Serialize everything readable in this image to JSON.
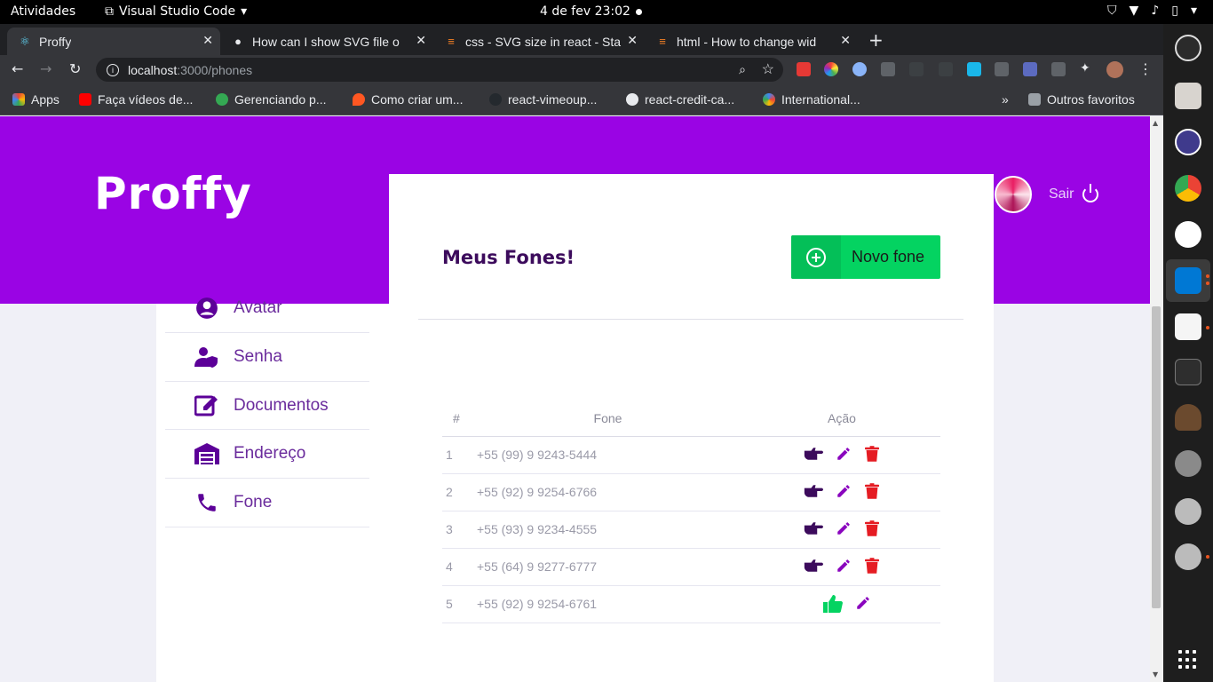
{
  "system_bar": {
    "activities": "Atividades",
    "app_name": "Visual Studio Code",
    "datetime": "4 de fev  23:02"
  },
  "browser": {
    "tabs": [
      {
        "title": "Proffy",
        "icon": "react-icon",
        "active": true
      },
      {
        "title": "How can I show SVG file o",
        "icon": "github-icon",
        "active": false
      },
      {
        "title": "css - SVG size in react - Sta",
        "icon": "stackoverflow-icon",
        "active": false
      },
      {
        "title": "html - How to change wid",
        "icon": "stackoverflow-icon",
        "active": false
      }
    ],
    "url_host": "localhost",
    "url_path": ":3000/phones",
    "bookmarks": [
      {
        "label": "Apps",
        "color": "#ea4335"
      },
      {
        "label": "Faça vídeos de...",
        "color": "#ff0000"
      },
      {
        "label": "Gerenciando p...",
        "color": "#34a853"
      },
      {
        "label": "Como criar um...",
        "color": "#ff5722"
      },
      {
        "label": "react-vimeoup...",
        "color": "#24292e"
      },
      {
        "label": "react-credit-ca...",
        "color": "#e8eaed"
      },
      {
        "label": "International...",
        "color": "#4285f4"
      }
    ],
    "other_bookmarks": "Outros favoritos"
  },
  "header": {
    "logo": "Proffy",
    "logout": "Sair"
  },
  "sidebar": {
    "items": [
      {
        "label": "Avatar",
        "icon": "user-circle-icon"
      },
      {
        "label": "Senha",
        "icon": "user-shield-icon"
      },
      {
        "label": "Documentos",
        "icon": "edit-document-icon"
      },
      {
        "label": "Endereço",
        "icon": "warehouse-icon"
      },
      {
        "label": "Fone",
        "icon": "phone-icon"
      }
    ]
  },
  "main": {
    "title": "Meus Fones!",
    "new_button": "Novo fone",
    "table": {
      "headers": [
        "#",
        "Fone",
        "Ação"
      ],
      "rows": [
        {
          "n": "1",
          "phone": "+55 (99) 9 9243-5444",
          "primary": false
        },
        {
          "n": "2",
          "phone": "+55 (92) 9 9254-6766",
          "primary": false
        },
        {
          "n": "3",
          "phone": "+55 (93) 9 9234-4555",
          "primary": false
        },
        {
          "n": "4",
          "phone": "+55 (64) 9 9277-6777",
          "primary": false
        },
        {
          "n": "5",
          "phone": "+55 (92) 9 9254-6761",
          "primary": true
        }
      ]
    }
  },
  "colors": {
    "brand_purple": "#9a04e4",
    "title_purple": "#3c0b5c",
    "accent_green": "#04d361",
    "delete_red": "#e51c23"
  }
}
